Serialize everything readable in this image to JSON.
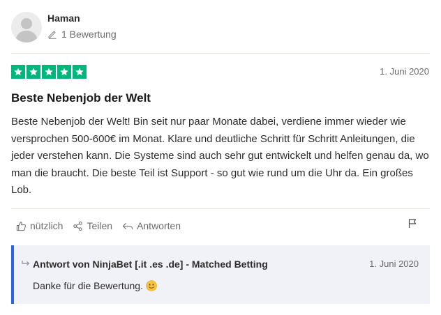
{
  "author": {
    "name": "Haman",
    "review_count": "1 Bewertung",
    "avatar_icon": "user-silhouette-icon"
  },
  "review": {
    "rating": 5,
    "rating_max": 5,
    "star_color": "#00b67a",
    "date": "1. Juni 2020",
    "title": "Beste Nebenjob der Welt",
    "body": "Beste Nebenjob der Welt! Bin seit nur paar Monate dabei, verdiene immer wieder wie versprochen 500-600€ im Monat. Klare und deutliche Schritt für Schritt Anleitungen, die jeder verstehen kann. Die Systeme sind auch sehr gut entwickelt und helfen genau da, wo man die braucht. Die beste Teil ist Support - so gut wie rund um die Uhr da. Ein großes Lob."
  },
  "actions": {
    "useful_label": "nützlich",
    "share_label": "Teilen",
    "reply_label": "Antworten",
    "flag_icon": "flag-icon"
  },
  "reply": {
    "author": "Antwort von NinjaBet [.it .es .de] - Matched Betting",
    "date": "1. Juni 2020",
    "text": "Danke für die Bewertung.",
    "accent_color": "#2e63e6",
    "emoji_icon": "smiling-face-emoji"
  }
}
